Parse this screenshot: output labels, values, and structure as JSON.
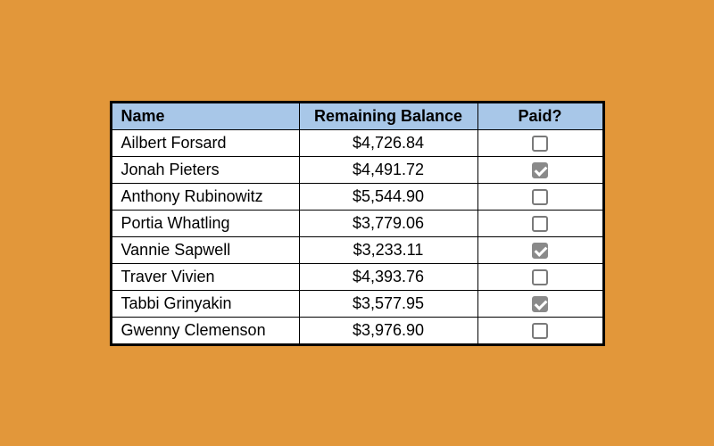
{
  "table": {
    "headers": {
      "name": "Name",
      "balance": "Remaining Balance",
      "paid": "Paid?"
    },
    "rows": [
      {
        "name": "Ailbert Forsard",
        "balance": "$4,726.84",
        "paid": false
      },
      {
        "name": "Jonah Pieters",
        "balance": "$4,491.72",
        "paid": true
      },
      {
        "name": "Anthony Rubinowitz",
        "balance": "$5,544.90",
        "paid": false
      },
      {
        "name": "Portia Whatling",
        "balance": "$3,779.06",
        "paid": false
      },
      {
        "name": "Vannie Sapwell",
        "balance": "$3,233.11",
        "paid": true
      },
      {
        "name": "Traver Vivien",
        "balance": "$4,393.76",
        "paid": false
      },
      {
        "name": "Tabbi Grinyakin",
        "balance": "$3,577.95",
        "paid": true
      },
      {
        "name": "Gwenny Clemenson",
        "balance": "$3,976.90",
        "paid": false
      }
    ]
  }
}
